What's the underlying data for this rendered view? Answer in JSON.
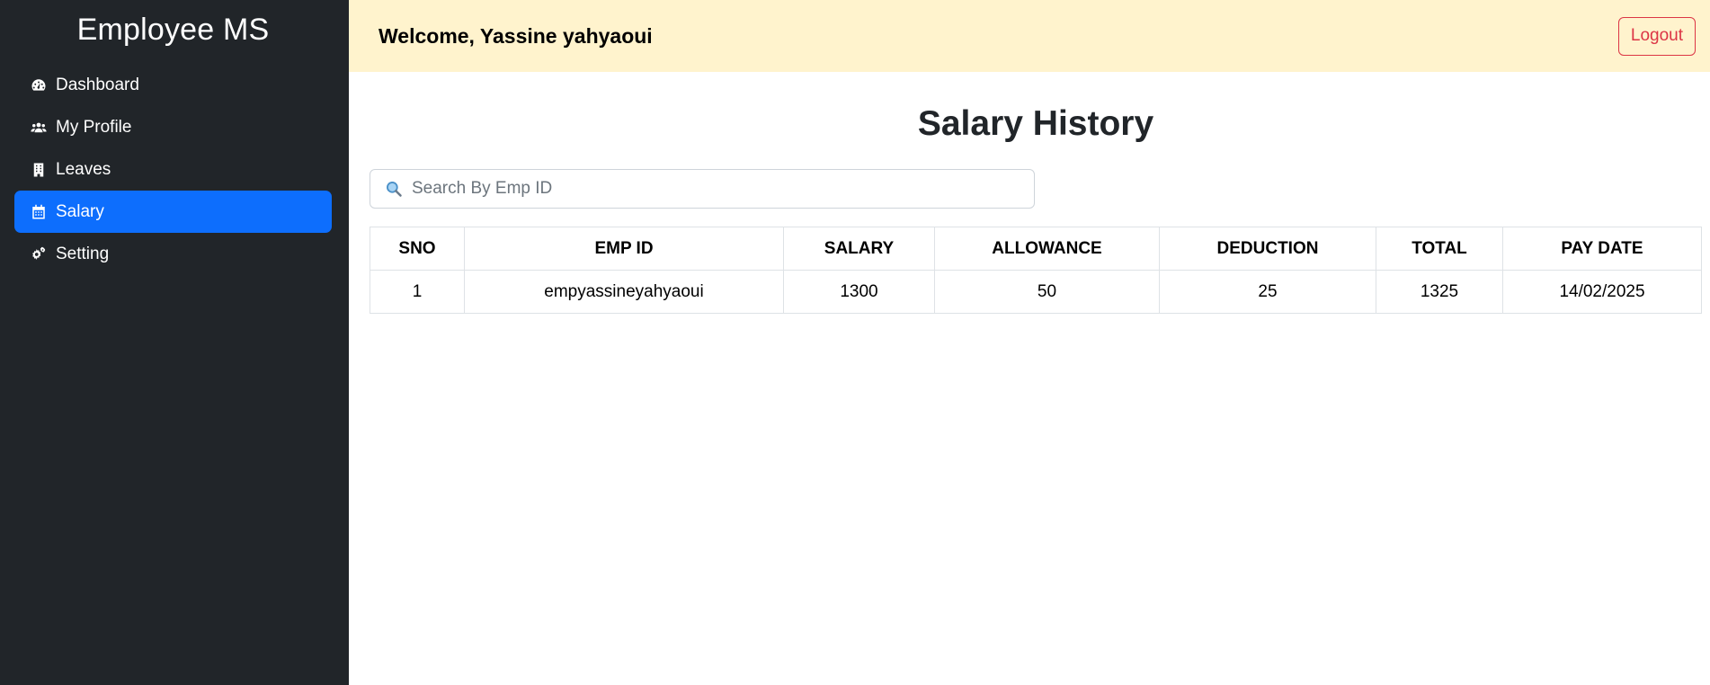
{
  "sidebar": {
    "brand": "Employee MS",
    "items": [
      {
        "label": "Dashboard",
        "icon": "dashboard-icon",
        "active": false
      },
      {
        "label": "My Profile",
        "icon": "users-icon",
        "active": false
      },
      {
        "label": "Leaves",
        "icon": "building-icon",
        "active": false
      },
      {
        "label": "Salary",
        "icon": "calendar-icon",
        "active": true
      },
      {
        "label": "Setting",
        "icon": "gears-icon",
        "active": false
      }
    ]
  },
  "header": {
    "welcome": "Welcome, Yassine yahyaoui",
    "logout_label": "Logout"
  },
  "main": {
    "title": "Salary History",
    "search": {
      "placeholder": "Search By Emp ID",
      "value": ""
    },
    "table": {
      "columns": [
        "SNO",
        "EMP ID",
        "SALARY",
        "ALLOWANCE",
        "DEDUCTION",
        "TOTAL",
        "PAY DATE"
      ],
      "rows": [
        [
          "1",
          "empyassineyahyaoui",
          "1300",
          "50",
          "25",
          "1325",
          "14/02/2025"
        ]
      ]
    }
  },
  "colors": {
    "sidebar_bg": "#212529",
    "active_item": "#0d6efd",
    "header_bg": "#fff3cd",
    "logout": "#dc3545"
  }
}
